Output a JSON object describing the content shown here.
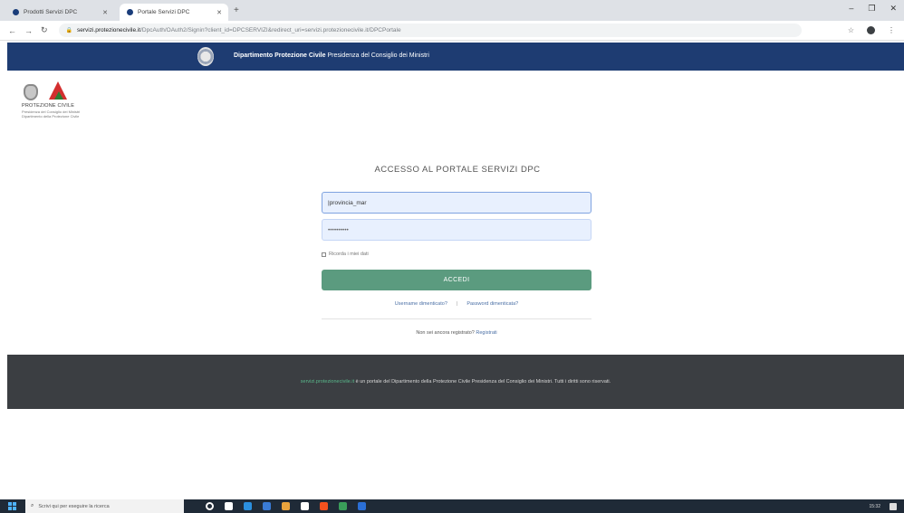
{
  "browser": {
    "tabs": [
      {
        "label": "Prodotti Servizi DPC",
        "active": false
      },
      {
        "label": "Portale Servizi DPC",
        "active": true
      }
    ],
    "new_tab": "+",
    "window_controls": [
      "–",
      "❐",
      "✕"
    ],
    "nav": [
      "←",
      "→",
      "↻"
    ],
    "url_host": "servizi.protezionecivile.it",
    "url_path": "/DpcAuth/OAuth2/Signin?client_id=DPCSERVIZI&redirect_uri=servizi.protezionecivile.it/DPCPortale",
    "right_icons": [
      "☆",
      "⋮"
    ]
  },
  "header": {
    "dept_bold": "Dipartimento Protezione Civile",
    "dept_rest": " Presidenza del Consiglio dei Ministri"
  },
  "logo": {
    "name": "PROTEZIONE CIVILE",
    "subtitle": "Presidenza del Consiglio dei Ministri Dipartimento della Protezione Civile"
  },
  "login": {
    "title": "ACCESSO AL PORTALE SERVIZI DPC",
    "username_value": "|provincia_mar",
    "password_value": "••••••••••",
    "remember_label": "Ricorda i miei dati",
    "submit_label": "ACCEDI",
    "forgot_username": "Username dimenticato?",
    "link_separator": "|",
    "forgot_password": "Password dimenticata?",
    "register_prompt": "Non sei ancora registrato? ",
    "register_link": "Registrati"
  },
  "footer": {
    "link": "servizi.protezionecivile.it",
    "text": " è un portale del Dipartimento della Protezione Civile Presidenza del Consiglio dei Ministri. Tutti i diritti sono riservati."
  },
  "taskbar": {
    "search_placeholder": "Scrivi qui per eseguire la ricerca",
    "icon_colors": [
      "#ffffff",
      "#ffffff",
      "#2b8fde",
      "#3a7bd5",
      "#e8a33d",
      "#ffffff",
      "#f4511e",
      "#3a9e5a",
      "#2b6fd6"
    ],
    "clock": "15:32"
  },
  "colors": {
    "header_bg": "#1e3c72",
    "button": "#5b9b7f",
    "footer_bg": "#3b3e42",
    "footer_link": "#59b88b"
  }
}
